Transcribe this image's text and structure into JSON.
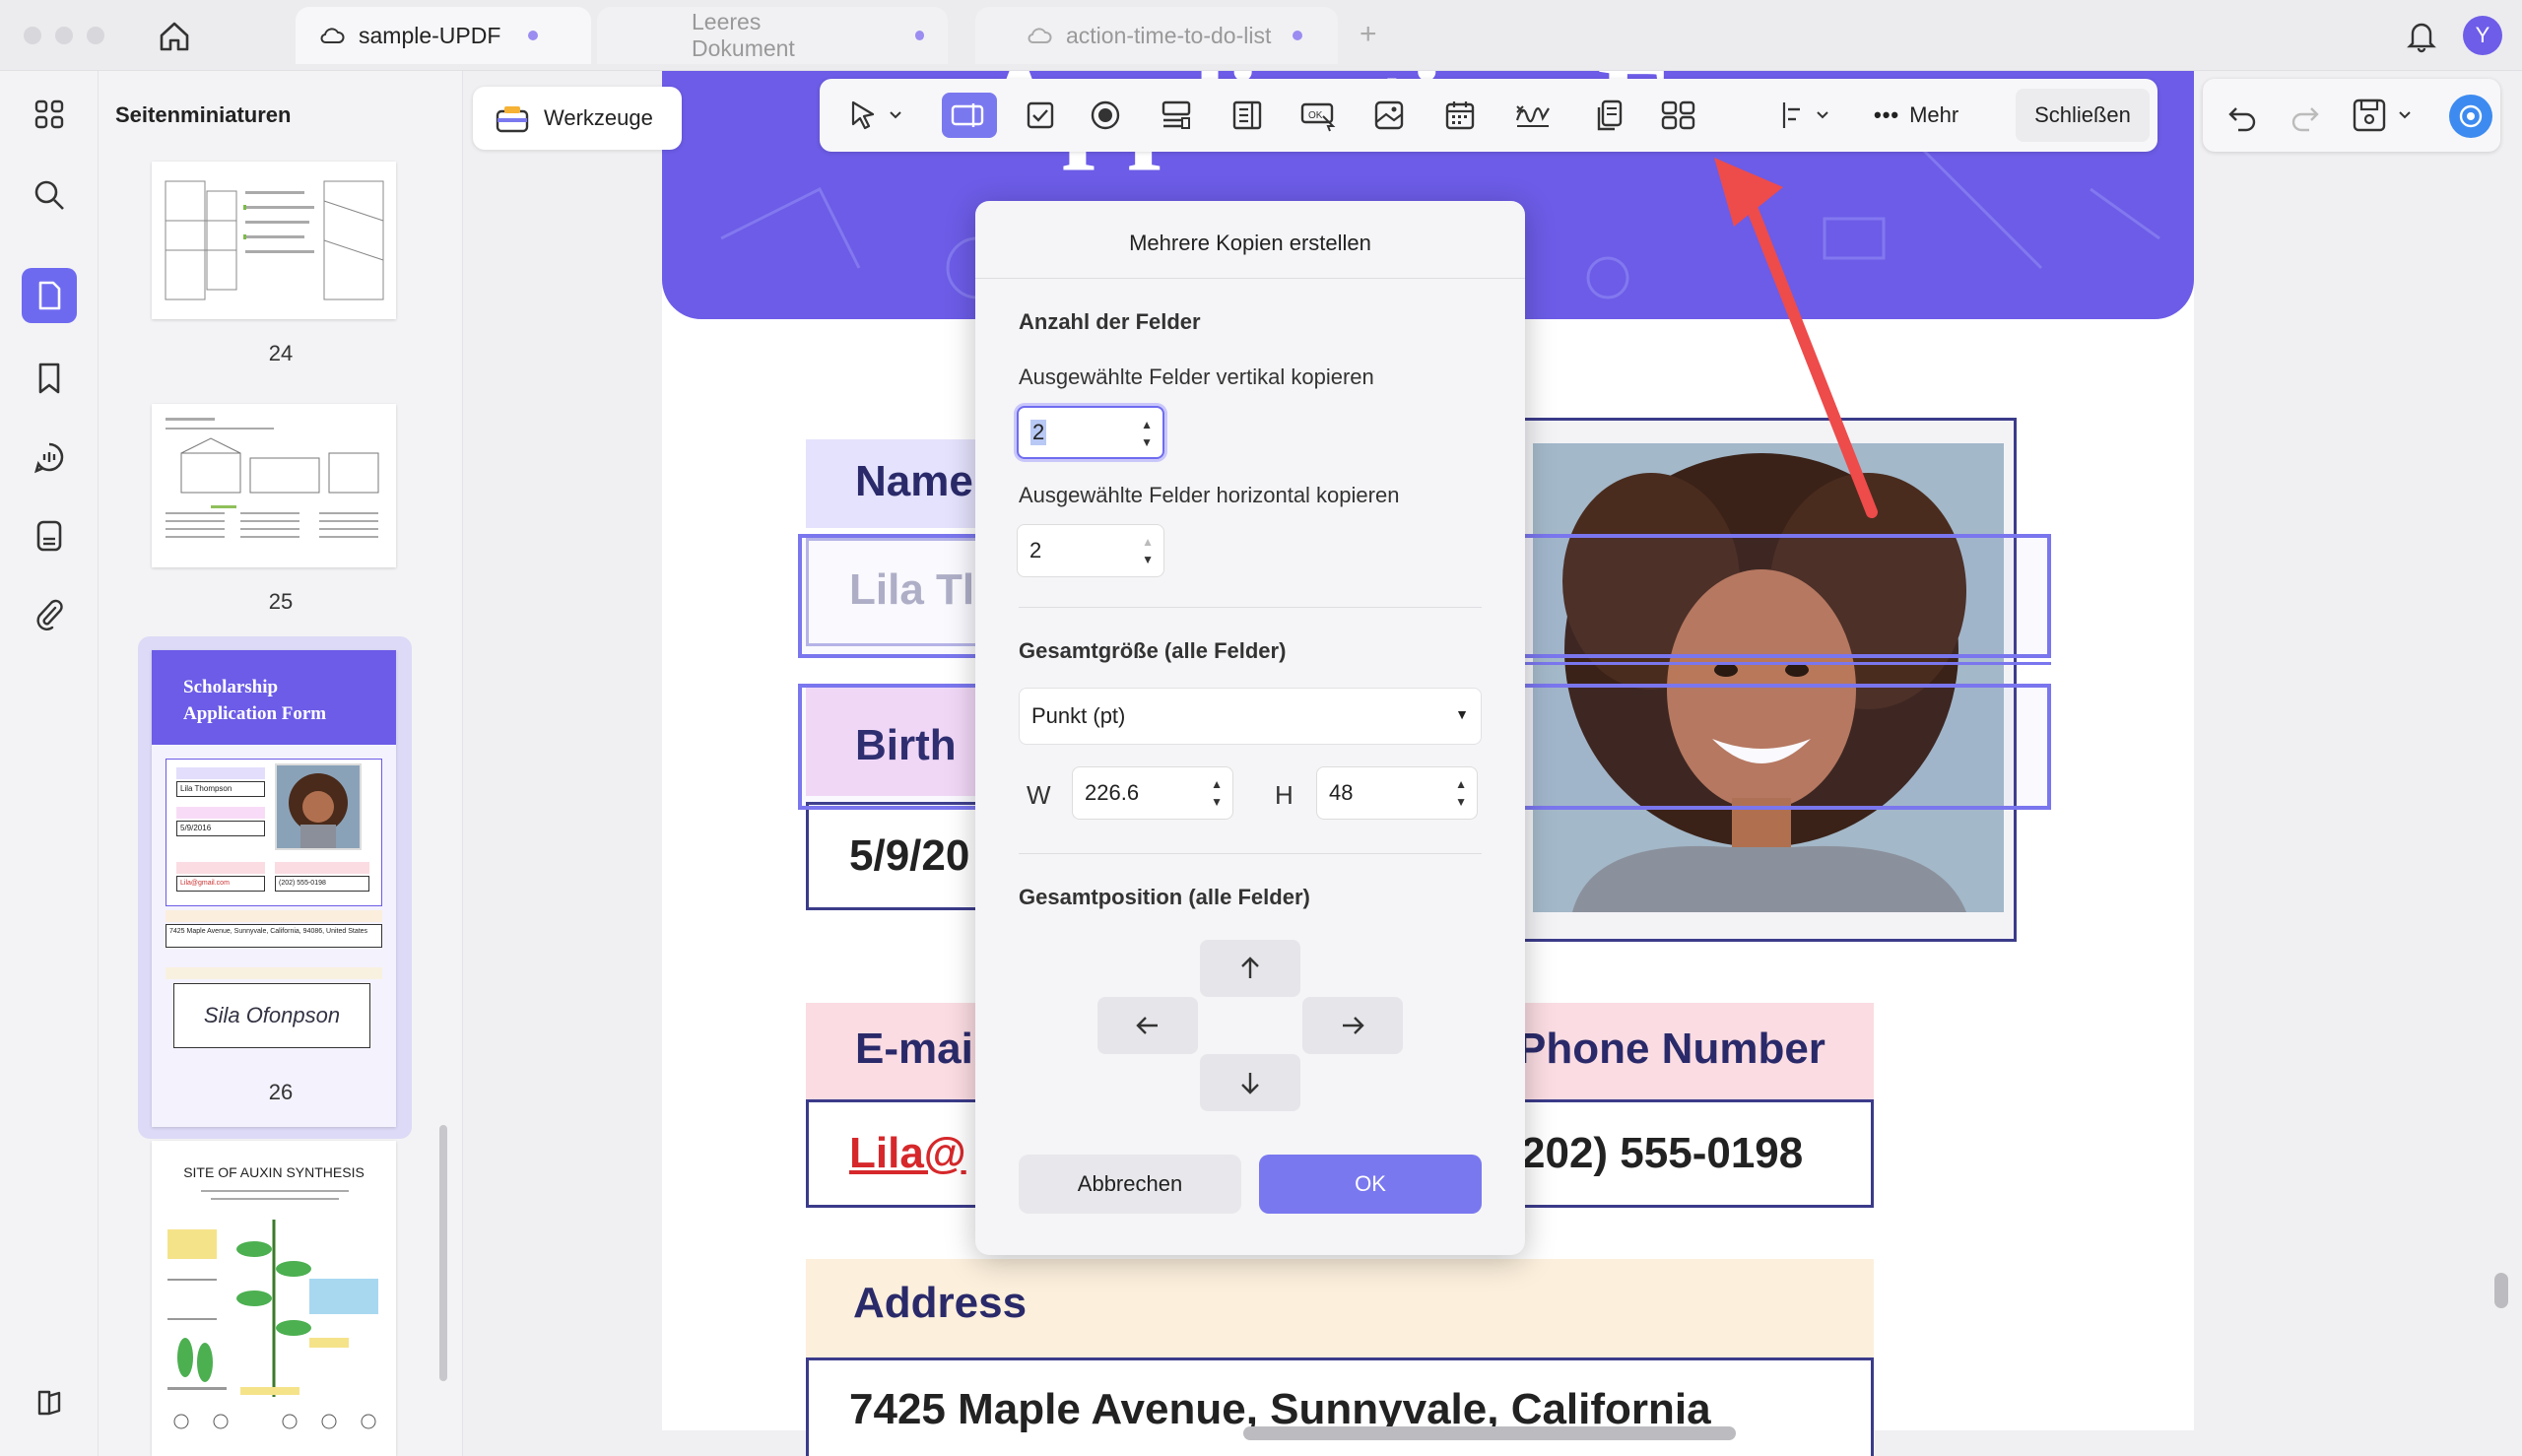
{
  "tabs": [
    {
      "label": "sample-UPDF",
      "active": true
    },
    {
      "label": "Leeres Dokument",
      "active": false
    },
    {
      "label": "action-time-to-do-list",
      "active": false
    }
  ],
  "avatar": "Y",
  "sidebar": {
    "title": "Seitenminiaturen",
    "pages": [
      "24",
      "25",
      "26"
    ],
    "thumb26": {
      "title_line1": "Scholarship",
      "title_line2": "Application Form",
      "signature": "Sila Ofonpson",
      "name": "Lila Thompson",
      "date": "5/9/2016",
      "email": "Lila@gmail.com",
      "phone": "(202) 555-0198",
      "address": "7425 Maple Avenue, Sunnyvale, California, 94086, United States"
    },
    "thumb27_title": "SITE OF AUXIN SYNTHESIS"
  },
  "toolbar": {
    "tools_label": "Werkzeuge",
    "more_label": "Mehr",
    "close_label": "Schließen"
  },
  "document": {
    "header_title": "Application Form",
    "name_label": "Name",
    "name_value": "Lila Tl",
    "birth_label": "Birth",
    "birth_value": "5/9/20",
    "email_label": "E-mai",
    "email_value": "Lila@",
    "phone_label": "Phone Number",
    "phone_value": "202) 555-0198",
    "address_label": "Address",
    "address_value": "7425 Maple Avenue, Sunnyvale, California"
  },
  "dialog": {
    "title": "Mehrere Kopien erstellen",
    "count_heading": "Anzahl der Felder",
    "vertical_label": "Ausgewählte Felder vertikal kopieren",
    "vertical_value": "2",
    "horizontal_label": "Ausgewählte Felder horizontal kopieren",
    "horizontal_value": "2",
    "size_heading": "Gesamtgröße (alle Felder)",
    "unit_value": "Punkt (pt)",
    "w_label": "W",
    "w_value": "226.6",
    "h_label": "H",
    "h_value": "48",
    "position_heading": "Gesamtposition (alle Felder)",
    "cancel_label": "Abbrechen",
    "ok_label": "OK"
  },
  "colors": {
    "accent": "#7a78ef",
    "header_purple": "#6c5ce7",
    "annotation_arrow": "#ee4b4b"
  }
}
